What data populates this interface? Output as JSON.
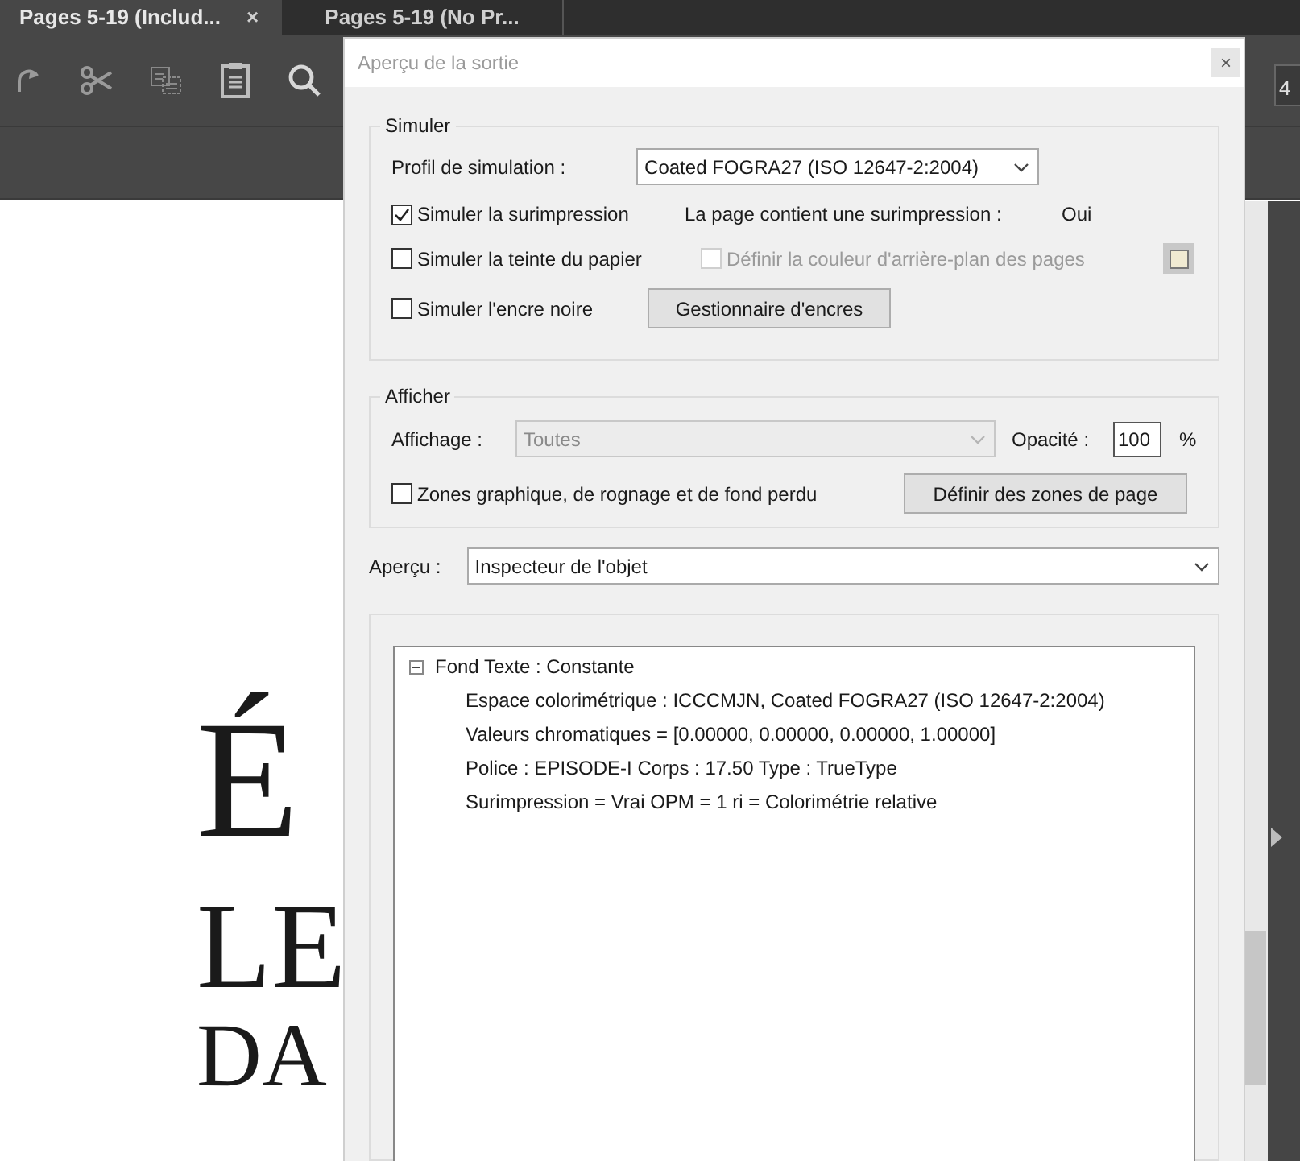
{
  "tabs": [
    {
      "label": "Pages 5-19 (Includ...",
      "selected": true,
      "close": "×"
    },
    {
      "label": "Pages 5-19 (No Pr...",
      "selected": false
    }
  ],
  "page_number": "4",
  "document": {
    "lines": [
      "É",
      "LE",
      "DA"
    ]
  },
  "dialog": {
    "title": "Aperçu de la sortie",
    "close": "×",
    "simuler": {
      "legend": "Simuler",
      "profile_label": "Profil de simulation :",
      "profile_value": "Coated FOGRA27 (ISO 12647-2:2004)",
      "overprint": {
        "label": "Simuler la surimpression",
        "checked": true
      },
      "overprint_info_label": "La page contient une surimpression :",
      "overprint_info_value": "Oui",
      "paper": {
        "label": "Simuler la teinte du papier",
        "checked": false
      },
      "background": {
        "label": "Définir la couleur d'arrière-plan des pages",
        "checked": false,
        "disabled": true,
        "color": "#f0ead2"
      },
      "black_ink": {
        "label": "Simuler l'encre noire",
        "checked": false
      },
      "ink_button": "Gestionnaire d'encres"
    },
    "afficher": {
      "legend": "Afficher",
      "display_label": "Affichage :",
      "display_value": "Toutes",
      "display_disabled": true,
      "opacity_label": "Opacité :",
      "opacity_value": "100",
      "percent": "%",
      "zones": {
        "label": "Zones graphique, de rognage et de fond perdu",
        "checked": false
      },
      "zones_button": "Définir des zones de page"
    },
    "apercu": {
      "label": "Aperçu :",
      "value": "Inspecteur de l'objet"
    },
    "inspector": {
      "label": "Fond Texte : Constante",
      "expanded": true,
      "children": [
        {
          "label": "Espace colorimétrique : ICCCMJN, Coated FOGRA27 (ISO 12647-2:2004)"
        },
        {
          "label": "Valeurs chromatiques = [0.00000, 0.00000, 0.00000, 1.00000]"
        },
        {
          "label": "Police : EPISODE-I Corps : 17.50 Type : TrueType"
        },
        {
          "label": "Surimpression = Vrai OPM = 1 ri = Colorimétrie relative"
        }
      ]
    }
  }
}
